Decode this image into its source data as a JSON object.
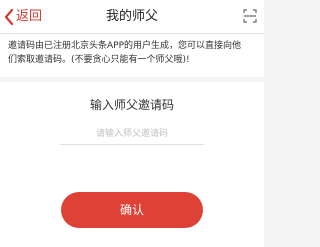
{
  "nav": {
    "back_label": "返回",
    "title": "我的师父",
    "back_icon": "chevron-left-icon",
    "scan_icon": "scan-icon"
  },
  "notice": {
    "text": "邀请码由已注册北京头条APP的用户生成，您可以直接向他\n们索取邀请码。(不要贪心只能有一个师父哦)!"
  },
  "invite": {
    "title": "输入师父邀请码",
    "placeholder": "请输入师父邀请码",
    "value": "",
    "confirm_label": "确认"
  },
  "colors": {
    "accent": "#d33a2c",
    "button": "#de4237",
    "background": "#f4f4f4"
  }
}
